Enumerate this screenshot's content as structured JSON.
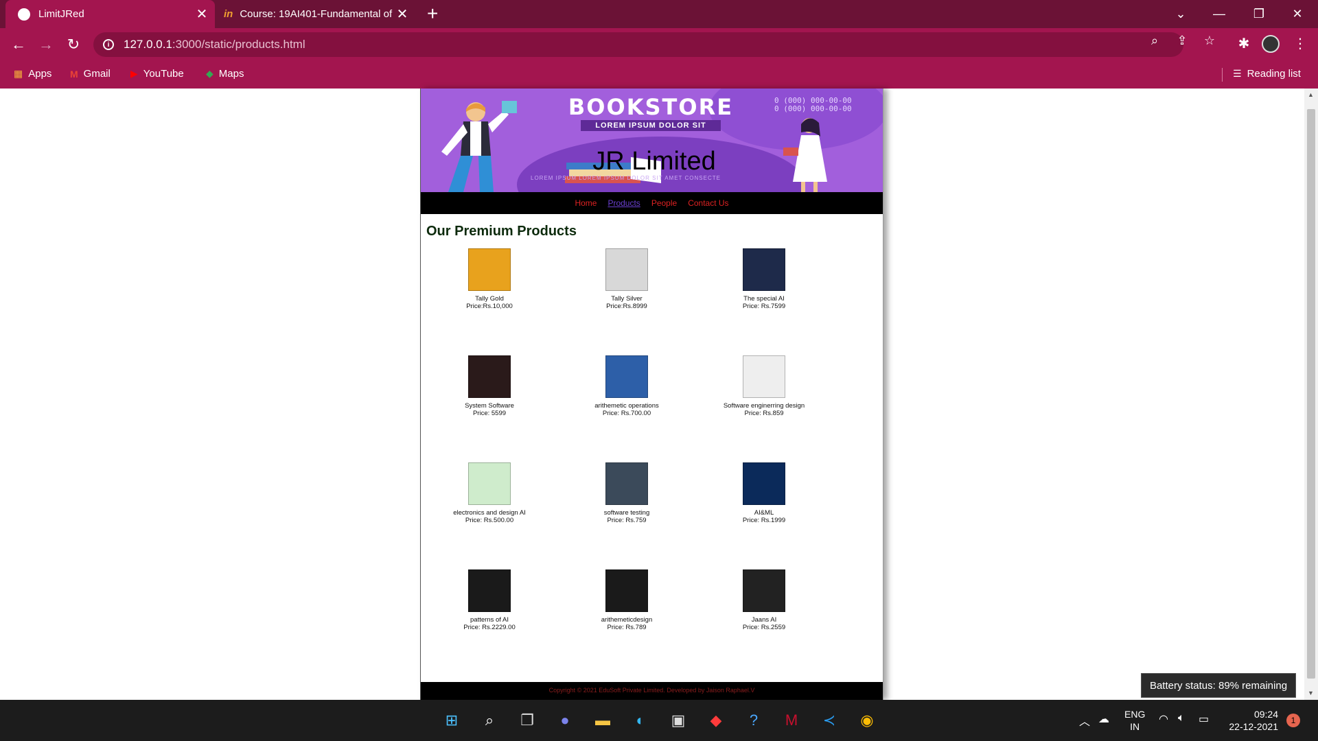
{
  "browser": {
    "tabs": [
      {
        "title": "LimitJRed",
        "active": true
      },
      {
        "title": "Course: 19AI401-Fundamental of",
        "active": false
      }
    ],
    "url_host": "127.0.0.1",
    "url_path": ":3000/static/products.html",
    "bookmarks": [
      "Apps",
      "Gmail",
      "YouTube",
      "Maps"
    ],
    "reading_list": "Reading list"
  },
  "site": {
    "banner": {
      "headline": "BOOKSTORE",
      "tagline": "LOREM IPSUM DOLOR SIT",
      "phone1": "0 (000) 000-00-00",
      "phone2": "0 (000) 000-00-00",
      "footline": "LOREM IPSUM LOREM IPSUM DOLOR SIT AMET CONSECTE",
      "brand": "JR Limited"
    },
    "nav": [
      {
        "label": "Home",
        "current": false
      },
      {
        "label": "Products",
        "current": true
      },
      {
        "label": "People",
        "current": false
      },
      {
        "label": "Contact Us",
        "current": false
      }
    ],
    "section_title": "Our Premium Products",
    "products": [
      {
        "name": "Tally Gold",
        "price": "Price:Rs.10,000",
        "cover": "#e8a21d"
      },
      {
        "name": "Tally Silver",
        "price": "Price:Rs.8999",
        "cover": "#d8d8d8"
      },
      {
        "name": "The special AI",
        "price": "Price: Rs.7599",
        "cover": "#1e2a4a"
      },
      {
        "name": "System Software",
        "price": "Price: 5599",
        "cover": "#2a1a1a"
      },
      {
        "name": "arithemetic operations",
        "price": "Price: Rs.700.00",
        "cover": "#2d5fa8"
      },
      {
        "name": "Software enginerring design",
        "price": "Price: Rs.859",
        "cover": "#eeeeee"
      },
      {
        "name": "electronics and design AI",
        "price": "Price: Rs.500.00",
        "cover": "#cfeccc"
      },
      {
        "name": "software testing",
        "price": "Price: Rs.759",
        "cover": "#3b4a5a"
      },
      {
        "name": "AI&ML",
        "price": "Price: Rs.1999",
        "cover": "#0b2a5a"
      },
      {
        "name": "patterns of AI",
        "price": "Price: Rs.2229.00",
        "cover": "#1a1a1a"
      },
      {
        "name": "arithemeticdesign",
        "price": "Price: Rs.789",
        "cover": "#1a1a1a"
      },
      {
        "name": "Jaans AI",
        "price": "Price: Rs.2559",
        "cover": "#222222"
      }
    ],
    "copyright": "Copyright © 2021 EduSoft Private Limited. Developed by Jaison Raphael.V"
  },
  "battery_tooltip": "Battery status: 89% remaining",
  "taskbar": {
    "lang1": "ENG",
    "lang2": "IN",
    "time": "09:24",
    "date": "22-12-2021",
    "notifications": "1"
  }
}
